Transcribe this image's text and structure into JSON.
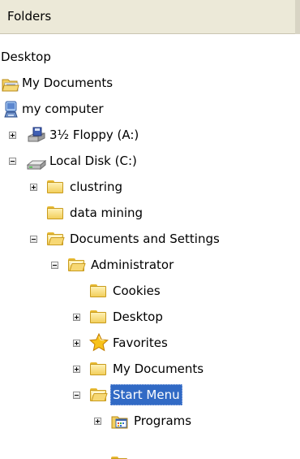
{
  "pane": {
    "title": "Folders"
  },
  "tree": {
    "desktop": "Desktop",
    "my_documents": "My Documents",
    "my_computer": "my computer",
    "floppy": "3½ Floppy (A:)",
    "local_disk": "Local Disk (C:)",
    "clustring": "clustring",
    "data_mining": "data mining",
    "documents_and_settings": "Documents and Settings",
    "administrator": "Administrator",
    "cookies": "Cookies",
    "admin_desktop": "Desktop",
    "favorites": "Favorites",
    "admin_my_documents": "My Documents",
    "start_menu": "Start Menu",
    "programs": "Programs"
  },
  "icons": {
    "desktop": "",
    "my_documents": "open-folder-icon",
    "my_computer": "computer-icon",
    "floppy": "floppy-drive-icon",
    "local_disk": "hard-disk-icon",
    "folders": "folder-icon",
    "favorites": "star-icon",
    "programs": "programs-folder-icon"
  },
  "colors": {
    "header_bg": "#ece9d8",
    "selection_bg": "#316ac5",
    "folder_yellow": "#f2cf5c",
    "star": "#f5b700"
  }
}
